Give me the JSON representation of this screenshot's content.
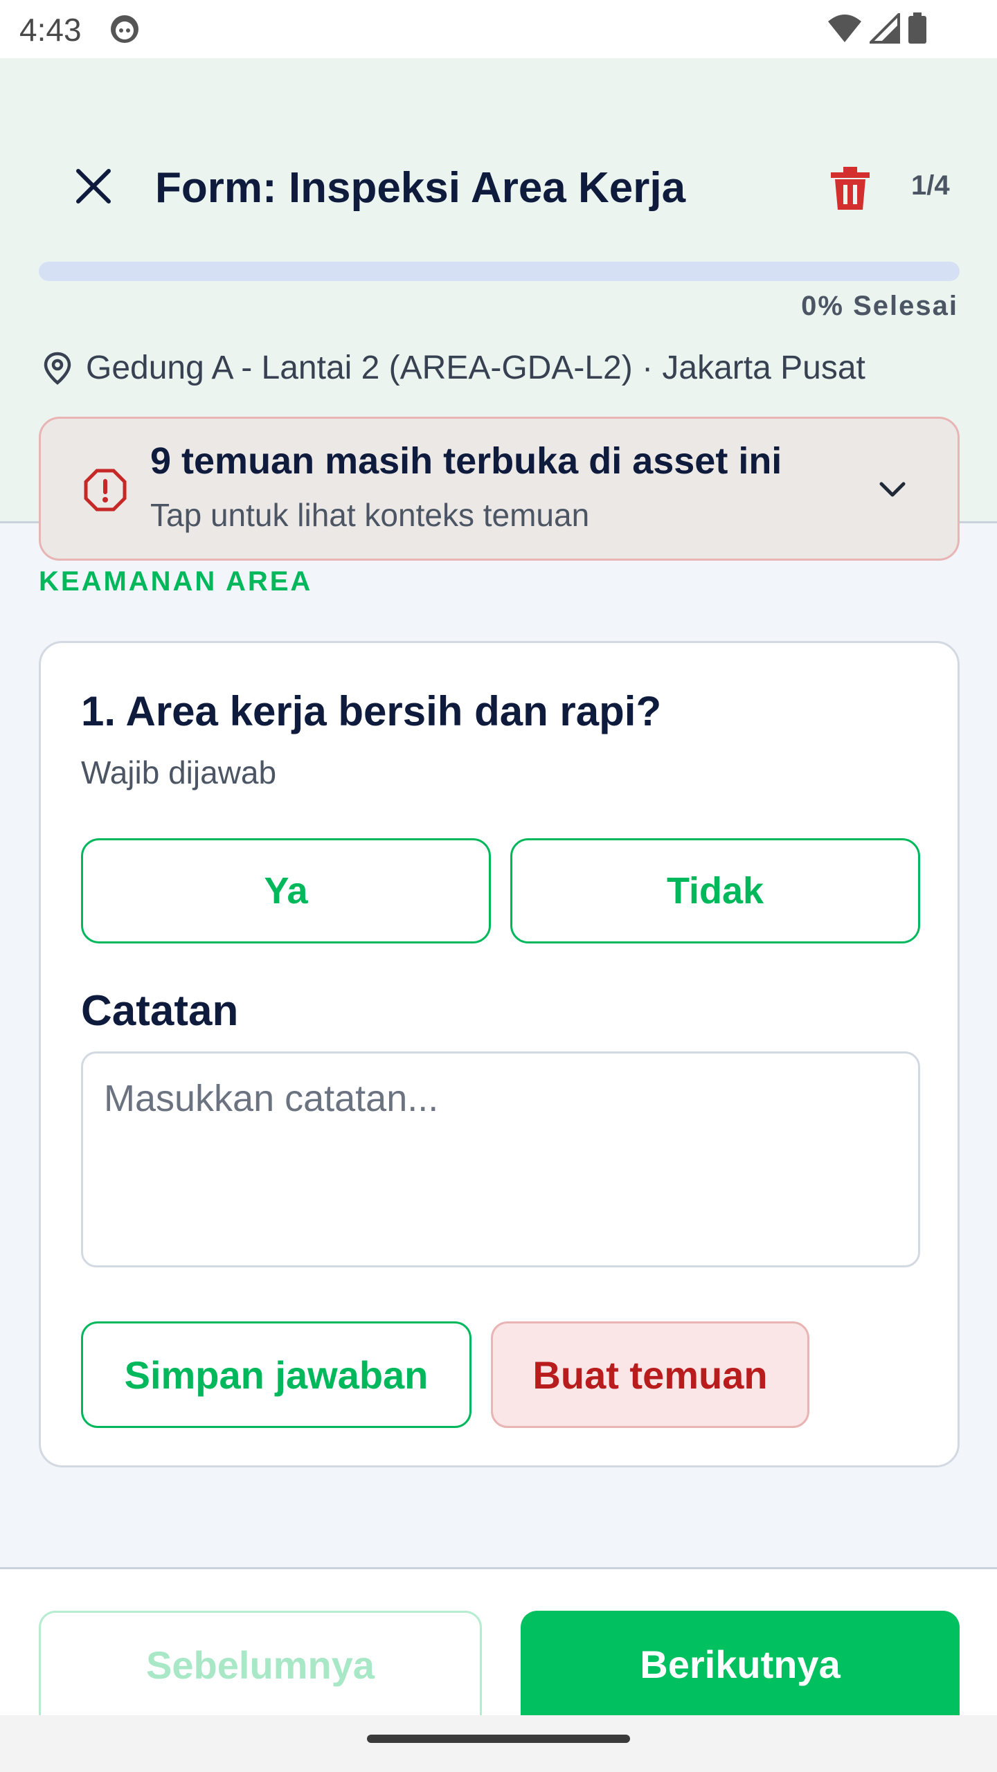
{
  "status_bar": {
    "time": "4:43"
  },
  "header": {
    "title": "Form: Inspeksi Area Kerja",
    "page_counter": "1/4",
    "progress_label": "0% Selesai",
    "progress_percent": 0,
    "location": "Gedung A - Lantai 2 (AREA-GDA-L2) · Jakarta Pusat"
  },
  "alert": {
    "title": "9 temuan masih terbuka di asset ini",
    "subtitle": "Tap untuk lihat konteks temuan"
  },
  "section": {
    "label": "KEAMANAN AREA"
  },
  "question": {
    "title": "1. Area kerja bersih dan rapi?",
    "required_text": "Wajib dijawab",
    "answer_yes": "Ya",
    "answer_no": "Tidak",
    "notes_label": "Catatan",
    "notes_placeholder": "Masukkan catatan...",
    "save_label": "Simpan jawaban",
    "finding_label": "Buat temuan"
  },
  "footer": {
    "prev_label": "Sebelumnya",
    "next_label": "Berikutnya"
  },
  "colors": {
    "accent_green": "#00c060",
    "danger_red": "#b91c1c",
    "header_bg": "#ebf4ef",
    "title_navy": "#0f1b3d"
  },
  "icons": [
    "close-icon",
    "trash-icon",
    "location-pin-icon",
    "alert-octagon-icon",
    "chevron-down-icon",
    "wifi-icon",
    "signal-icon",
    "battery-icon"
  ]
}
